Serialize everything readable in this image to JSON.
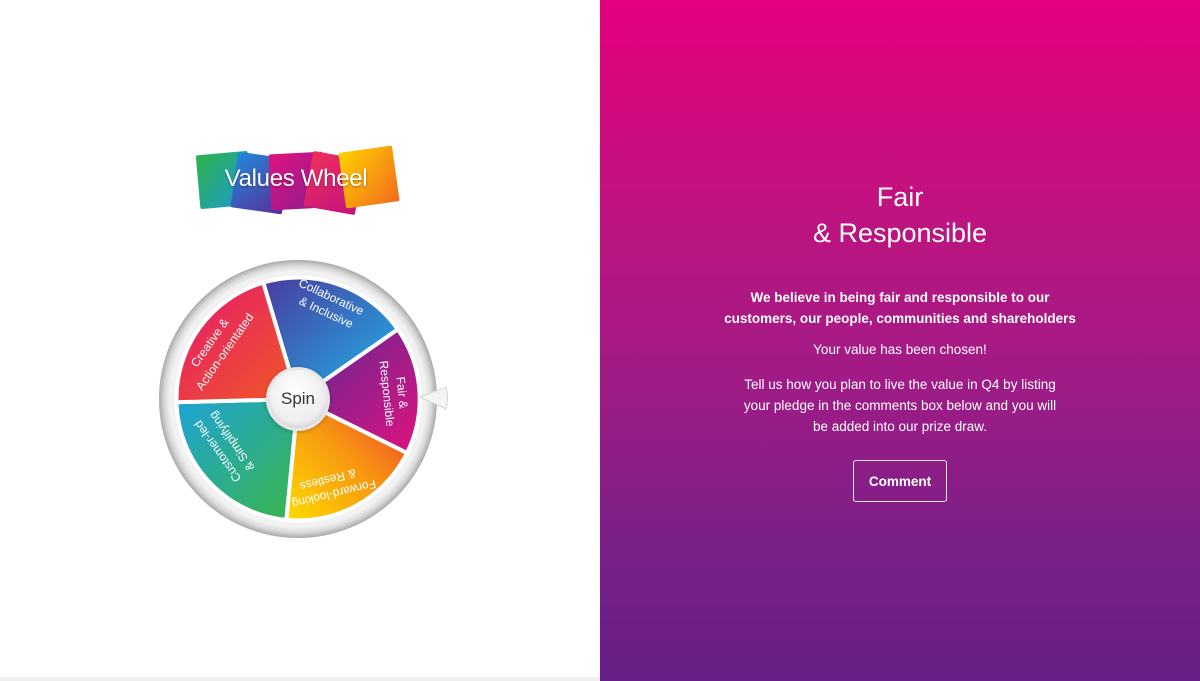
{
  "logo": {
    "text": "Values Wheel"
  },
  "wheel": {
    "spin_label": "Spin",
    "segments": [
      {
        "line1": "Collaborative",
        "line2": "& Inclusive"
      },
      {
        "line1": "Fair &",
        "line2": "Responsible"
      },
      {
        "line1": "Forward-looking",
        "line2": "& Restless"
      },
      {
        "line1": "Customer-led",
        "line2": "& Simplifying"
      },
      {
        "line1": "Creative &",
        "line2": "Action-orientated"
      }
    ]
  },
  "panel": {
    "title_line1": "Fair",
    "title_line2": "& Responsible",
    "statement_line1": "We believe in being fair and responsible to our",
    "statement_line2": "customers, our people, communities and shareholders",
    "chosen": "Your value has been chosen!",
    "instructions_line1": "Tell us how you plan to live the value in Q4 by listing",
    "instructions_line2": "your pledge in the comments box below and you will",
    "instructions_line3": "be added into our prize draw.",
    "comment_button": "Comment"
  },
  "colors": {
    "panel_top": "#e4007e",
    "panel_bottom": "#651f86",
    "segment_blue": "#2a8ed8",
    "segment_purple": "#a01a8c",
    "segment_orange": "#f27a12",
    "segment_green": "#22a88a",
    "segment_red": "#e8245c"
  }
}
